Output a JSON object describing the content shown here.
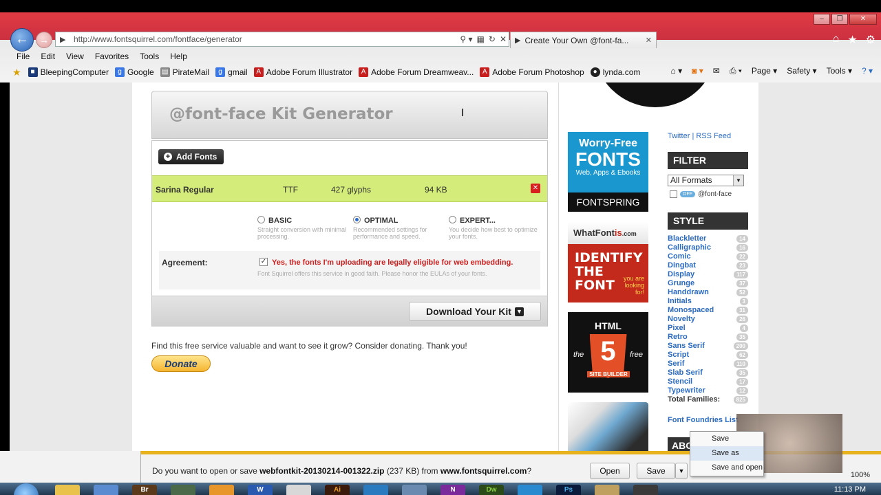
{
  "browser": {
    "url": "http://www.fontsquirrel.com/fontface/generator",
    "tab_title": "Create Your Own @font-fa...",
    "menu": [
      "File",
      "Edit",
      "View",
      "Favorites",
      "Tools",
      "Help"
    ],
    "favorites": [
      {
        "label": "BleepingComputer",
        "icon": "bleeping-icon",
        "color": "#1b3a7a"
      },
      {
        "label": "Google",
        "icon": "google-icon",
        "color": "#3b78e7"
      },
      {
        "label": "PirateMail",
        "icon": "page-icon",
        "color": "#888888"
      },
      {
        "label": "gmail",
        "icon": "google-icon",
        "color": "#3b78e7"
      },
      {
        "label": "Adobe Forum Illustrator",
        "icon": "adobe-icon",
        "color": "#c81e1e"
      },
      {
        "label": "Adobe Forum Dreamweav...",
        "icon": "adobe-icon",
        "color": "#c81e1e"
      },
      {
        "label": "Adobe Forum Photoshop",
        "icon": "adobe-icon",
        "color": "#c81e1e"
      },
      {
        "label": "lynda.com",
        "icon": "lynda-icon",
        "color": "#222222"
      }
    ],
    "command_bar": [
      "Page ▾",
      "Safety ▾",
      "Tools ▾"
    ]
  },
  "generator": {
    "title": "@font-face Kit Generator",
    "add_fonts_label": "Add Fonts",
    "font": {
      "name": "Sarina Regular",
      "type": "TTF",
      "glyphs": "427 glyphs",
      "size": "94 KB"
    },
    "modes": [
      {
        "label": "BASIC",
        "desc": "Straight conversion with minimal processing.",
        "selected": false
      },
      {
        "label": "OPTIMAL",
        "desc": "Recommended settings for performance and speed.",
        "selected": true
      },
      {
        "label": "EXPERT...",
        "desc": "You decide how best to optimize your fonts.",
        "selected": false
      }
    ],
    "agreement_label": "Agreement:",
    "agreement_text": "Yes, the fonts I'm uploading are legally eligible for web embedding.",
    "agreement_sub": "Font Squirrel offers this service in good faith. Please honor the EULAs of your fonts.",
    "download_label": "Download Your Kit"
  },
  "donate": {
    "text": "Find this free service valuable and want to see it grow? Consider donating. Thank you!",
    "button": "Donate"
  },
  "ads": {
    "fontspring": {
      "line1": "Worry-Free",
      "line2": "FONTS",
      "line3": "Web, Apps & Ebooks",
      "brand": "FONTSPRING"
    },
    "whatfontis": {
      "brand_a": "WhatFont",
      "brand_b": "is",
      "brand_c": ".com",
      "big": "IDENTIFY THE FONT",
      "small": "you are looking for!"
    },
    "html5": {
      "heading": "HTML",
      "digit": "5",
      "left": "the",
      "right": "free",
      "caption": "SITE BUILDER"
    }
  },
  "sidebar": {
    "links": "Twitter | RSS Feed",
    "filter_title": "FILTER",
    "filter_select": "All Formats",
    "filter_check": "@font-face",
    "filter_pill": "OFF",
    "style_title": "STYLE",
    "styles": [
      {
        "name": "Blackletter",
        "count": "14"
      },
      {
        "name": "Calligraphic",
        "count": "16"
      },
      {
        "name": "Comic",
        "count": "22"
      },
      {
        "name": "Dingbat",
        "count": "23"
      },
      {
        "name": "Display",
        "count": "117"
      },
      {
        "name": "Grunge",
        "count": "37"
      },
      {
        "name": "Handdrawn",
        "count": "52"
      },
      {
        "name": "Initials",
        "count": "3"
      },
      {
        "name": "Monospaced",
        "count": "31"
      },
      {
        "name": "Novelty",
        "count": "26"
      },
      {
        "name": "Pixel",
        "count": "4"
      },
      {
        "name": "Retro",
        "count": "35"
      },
      {
        "name": "Sans Serif",
        "count": "200"
      },
      {
        "name": "Script",
        "count": "62"
      },
      {
        "name": "Serif",
        "count": "110"
      },
      {
        "name": "Slab Serif",
        "count": "35"
      },
      {
        "name": "Stencil",
        "count": "17"
      },
      {
        "name": "Typewriter",
        "count": "12"
      }
    ],
    "total_label": "Total Families:",
    "total_count": "825",
    "foundries": "Font Foundries List",
    "about_title": "ABO"
  },
  "download_bar": {
    "prefix": "Do you want to open or save ",
    "file": "webfontkit-20130214-001322.zip",
    "size": " (237 KB) from ",
    "site": "www.fontsquirrel.com",
    "suffix": "?",
    "open": "Open",
    "save": "Save",
    "menu": [
      "Save",
      "Save as",
      "Save and open"
    ]
  },
  "status": {
    "zoom": "100%",
    "clock": "11:13 PM"
  }
}
